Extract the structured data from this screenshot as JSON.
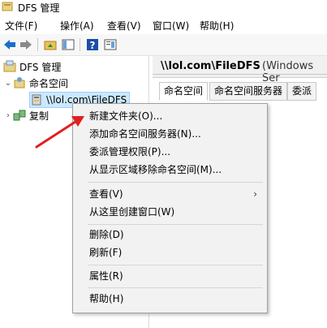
{
  "window": {
    "title": "DFS 管理"
  },
  "menubar": {
    "items": [
      "文件(F)",
      "操作(A)",
      "查看(V)",
      "窗口(W)",
      "帮助(H)"
    ]
  },
  "toolbar": {
    "icons": [
      "back-arrow-icon",
      "forward-arrow-icon",
      "up-folder-icon",
      "show-tree-icon",
      "help-icon",
      "properties-icon"
    ]
  },
  "tree": {
    "root": "DFS 管理",
    "namespaces": "命名空间",
    "namespace_item": "\\\\lol.com\\FileDFS",
    "replication": "复制"
  },
  "right_pane": {
    "title": "\\\\lol.com\\FileDFS",
    "title_extra": "(Windows Ser",
    "tabs": [
      "命名空间",
      "命名空间服务器",
      "委派"
    ]
  },
  "context_menu": {
    "items": [
      {
        "label": "新建文件夹(O)...",
        "submenu": false
      },
      {
        "label": "添加命名空间服务器(N)...",
        "submenu": false
      },
      {
        "label": "委派管理权限(P)...",
        "submenu": false
      },
      {
        "label": "从显示区域移除命名空间(M)...",
        "submenu": false
      },
      {
        "label": "查看(V)",
        "submenu": true
      },
      {
        "label": "从这里创建窗口(W)",
        "submenu": false
      },
      {
        "label": "删除(D)",
        "submenu": false
      },
      {
        "label": "刷新(F)",
        "submenu": false
      },
      {
        "label": "属性(R)",
        "submenu": false
      },
      {
        "label": "帮助(H)",
        "submenu": false
      }
    ],
    "submenu_arrow": "›"
  },
  "colors": {
    "selection": "#cce8ff",
    "annotation_arrow": "#e02020"
  }
}
